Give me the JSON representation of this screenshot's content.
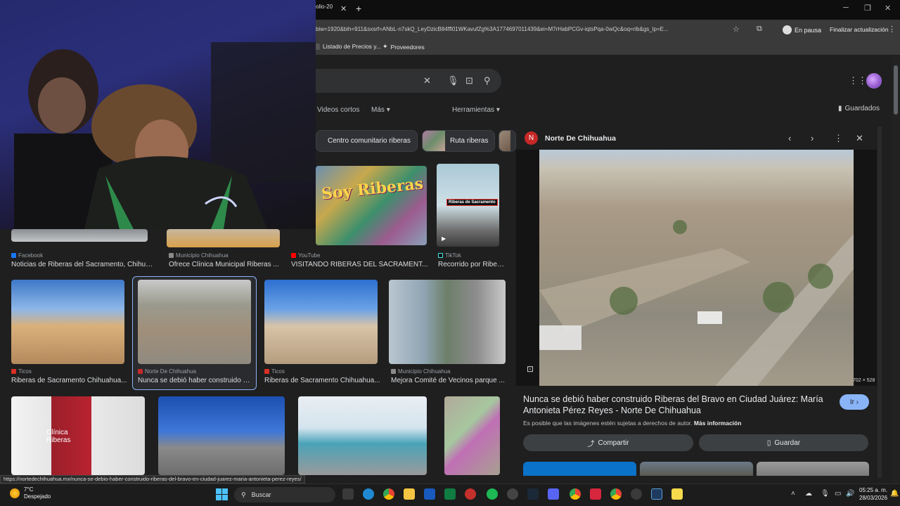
{
  "browser": {
    "tab_title": "olio-20",
    "url": "biw=1920&bih=911&sxsrf=ANbL-n7skQ_LeyDzicB84ffl01WKavufZg%3A1774697011439&ei=M7rHabPCGv-iqtsPqa-0wQc&oq=rib&gs_lp=E...",
    "paused_label": "En pausa",
    "update_label": "Finalizar actualización",
    "bookmarks": [
      "Listado de Precios y...",
      "Proveedores"
    ]
  },
  "search": {
    "filters": [
      "Videos cortos",
      "Más",
      "Herramientas"
    ],
    "saved_label": "Guardados",
    "chips": [
      "Centro comunitario riberas",
      "Ruta riberas"
    ]
  },
  "results": {
    "row1": [
      {
        "source": "Facebook",
        "title": "Noticias de Riberas del Sacramento, Chihuah..."
      },
      {
        "source": "Municipio Chihuahua",
        "title": "Ofrece Clínica Municipal Riberas ..."
      },
      {
        "source": "YouTube",
        "title": "VISITANDO RIBERAS DEL SACRAMENT...",
        "overlay": "Soy Riberas"
      },
      {
        "source": "TikTok",
        "title": "Recorrido por Riber...",
        "overlay": "Riberas de Sacramento"
      }
    ],
    "row2": [
      {
        "source": "Ticos",
        "title": "Riberas de Sacramento Chihuahua..."
      },
      {
        "source": "Norte De Chihuahua",
        "title": "Nunca se debió haber construido R..."
      },
      {
        "source": "Ticos",
        "title": "Riberas de Sacramento Chihuahua..."
      },
      {
        "source": "Municipio Chihuahua",
        "title": "Mejora Comité de Vecinos parque ..."
      }
    ],
    "row3_sign": "Clínica Riberas"
  },
  "panel": {
    "source": "Norte De Chihuahua",
    "logo_letter": "N",
    "dimensions": "702 × 528",
    "title": "Nunca se debió haber construido Riberas del Bravo en Ciudad Juárez: María Antonieta Pérez Reyes - Norte De Chihuahua",
    "go_label": "Ir",
    "copyright": "Es posible que las imágenes estén sujetas a derechos de autor.",
    "more_info": "Más información",
    "share_label": "Compartir",
    "save_label": "Guardar"
  },
  "status_link": "https://nortedechihuahua.mx/nunca-se-debio-haber-construido-riberas-del-bravo-en-ciudad-juarez-maria-antonieta-perez-reyes/",
  "taskbar": {
    "temperature": "7°C",
    "weather": "Despejado",
    "search_label": "Buscar",
    "time": "05:25 a. m.",
    "date": "28/03/2026"
  }
}
